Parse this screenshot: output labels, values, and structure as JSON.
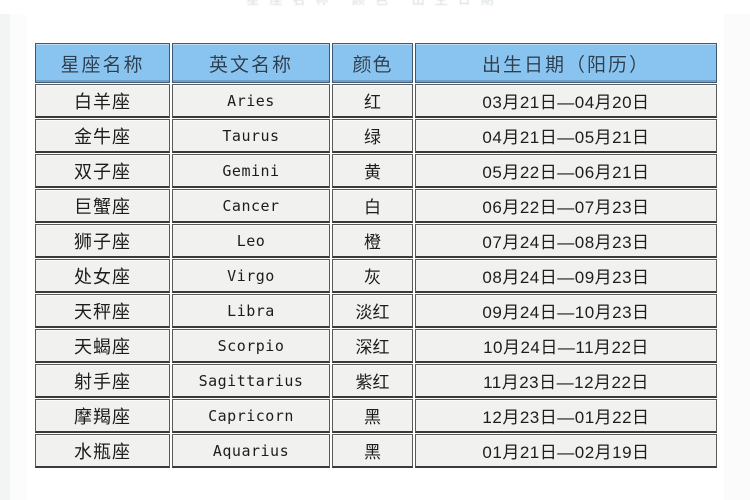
{
  "clipped_top_text": "星座名称 颜色 出生日期",
  "colors": {
    "header_bg": "#89C4F0",
    "header_border": "#3C5A73",
    "cell_bg": "#F1F1EF",
    "cell_border": "#5A5A5A",
    "page_bg": "#FFFFFF",
    "text": "#1D1D1D"
  },
  "table": {
    "headers": [
      "星座名称",
      "英文名称",
      "颜色",
      "出生日期（阳历）"
    ],
    "rows": [
      {
        "name": "白羊座",
        "en": "Aries",
        "color": "红",
        "date": "03月21日—04月20日"
      },
      {
        "name": "金牛座",
        "en": "Taurus",
        "color": "绿",
        "date": "04月21日—05月21日"
      },
      {
        "name": "双子座",
        "en": "Gemini",
        "color": "黄",
        "date": "05月22日—06月21日"
      },
      {
        "name": "巨蟹座",
        "en": "Cancer",
        "color": "白",
        "date": "06月22日—07月23日"
      },
      {
        "name": "狮子座",
        "en": "Leo",
        "color": "橙",
        "date": "07月24日—08月23日"
      },
      {
        "name": "处女座",
        "en": "Virgo",
        "color": "灰",
        "date": "08月24日—09月23日"
      },
      {
        "name": "天秤座",
        "en": "Libra",
        "color": "淡红",
        "date": "09月24日—10月23日"
      },
      {
        "name": "天蝎座",
        "en": "Scorpio",
        "color": "深红",
        "date": "10月24日—11月22日"
      },
      {
        "name": "射手座",
        "en": "Sagittarius",
        "color": "紫红",
        "date": "11月23日—12月22日"
      },
      {
        "name": "摩羯座",
        "en": "Capricorn",
        "color": "黑",
        "date": "12月23日—01月22日"
      },
      {
        "name": "水瓶座",
        "en": "Aquarius",
        "color": "黑",
        "date": "01月21日—02月19日"
      }
    ]
  }
}
